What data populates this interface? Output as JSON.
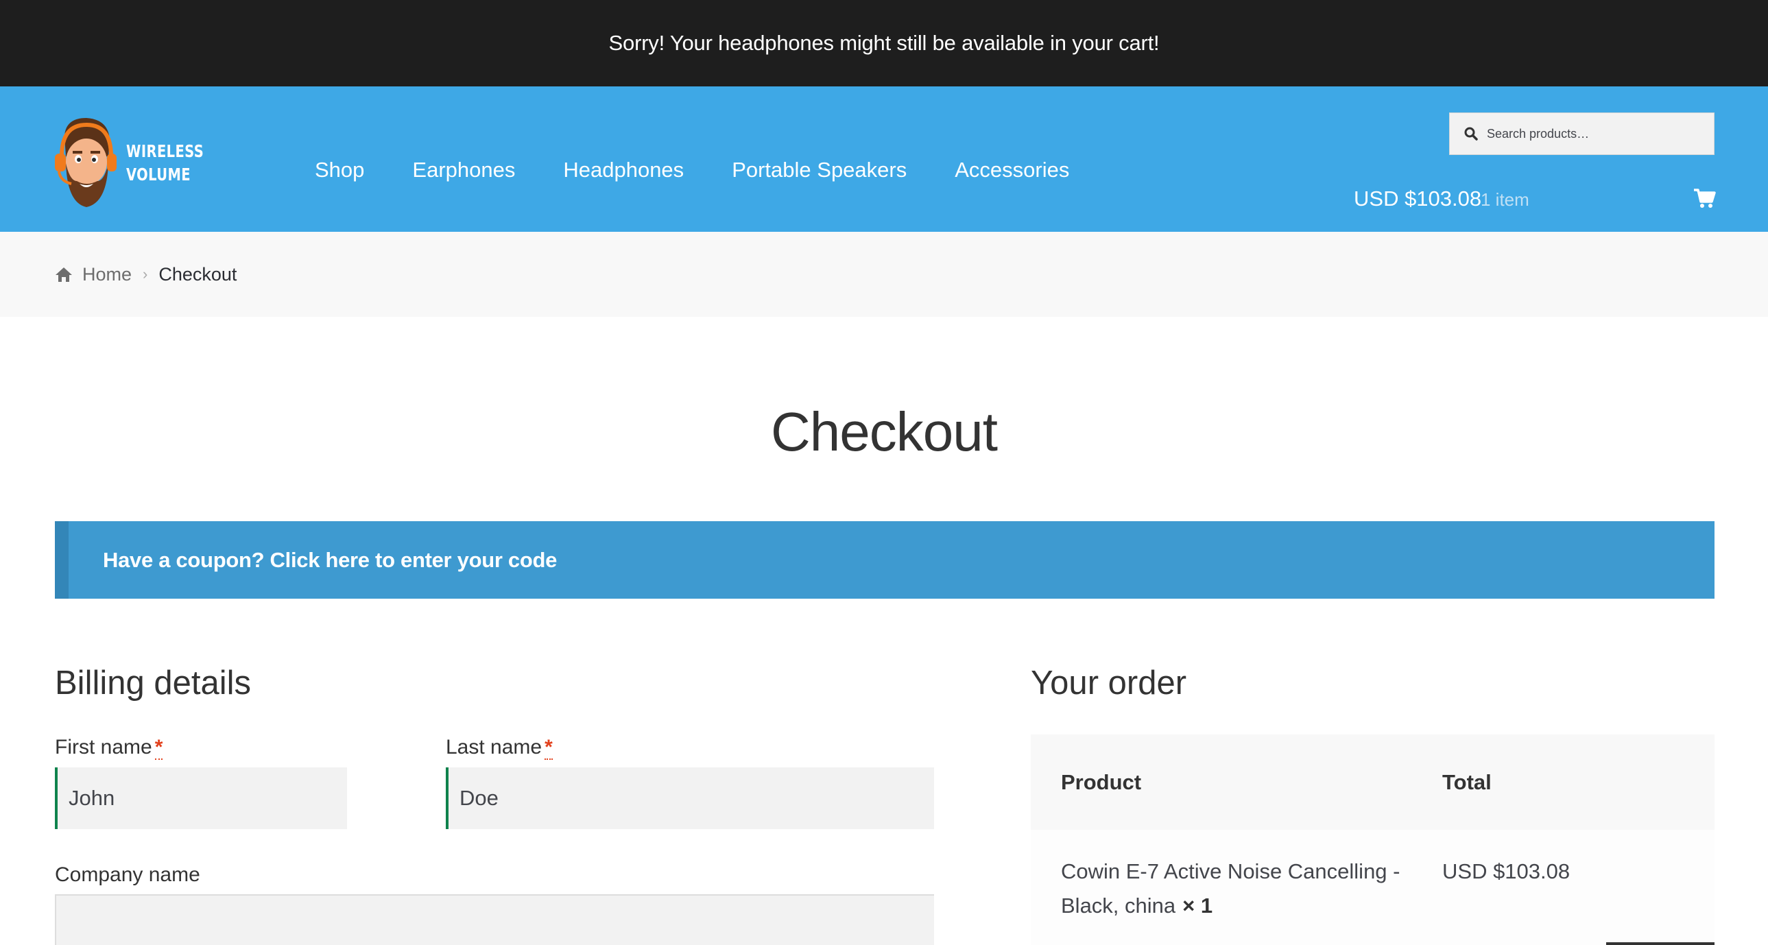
{
  "banner": {
    "text": "Sorry! Your headphones might still be available in your cart!"
  },
  "header": {
    "logo_line1": "WIRELESS",
    "logo_line2": "VOLUME",
    "nav": [
      "Shop",
      "Earphones",
      "Headphones",
      "Portable Speakers",
      "Accessories"
    ],
    "search": {
      "placeholder": "Search products…",
      "value": ""
    },
    "cart": {
      "amount": "USD $103.08",
      "count": "1 item"
    }
  },
  "breadcrumb": {
    "home": "Home",
    "current": "Checkout"
  },
  "page": {
    "title": "Checkout"
  },
  "coupon": {
    "text": "Have a coupon? Click here to enter your code"
  },
  "billing": {
    "title": "Billing details",
    "first_name": {
      "label": "First name",
      "required": "*",
      "value": "John"
    },
    "last_name": {
      "label": "Last name",
      "required": "*",
      "value": "Doe"
    },
    "company": {
      "label": "Company name",
      "value": ""
    }
  },
  "order": {
    "title": "Your order",
    "headers": {
      "product": "Product",
      "total": "Total"
    },
    "items": [
      {
        "name": "Cowin E-7 Active Noise Cancelling - Black, china",
        "qty": "× 1",
        "total": "USD $103.08"
      }
    ]
  },
  "colors": {
    "banner_bg": "#1e1e1e",
    "header_bg": "#3ea8e6",
    "coupon_bg": "#3e9ad0",
    "valid_field_border": "#0f834d",
    "required_marker": "#e2401c"
  },
  "icons": [
    "logo-avatar-icon",
    "search-icon",
    "cart-icon",
    "home-icon",
    "chevron-right-icon"
  ]
}
